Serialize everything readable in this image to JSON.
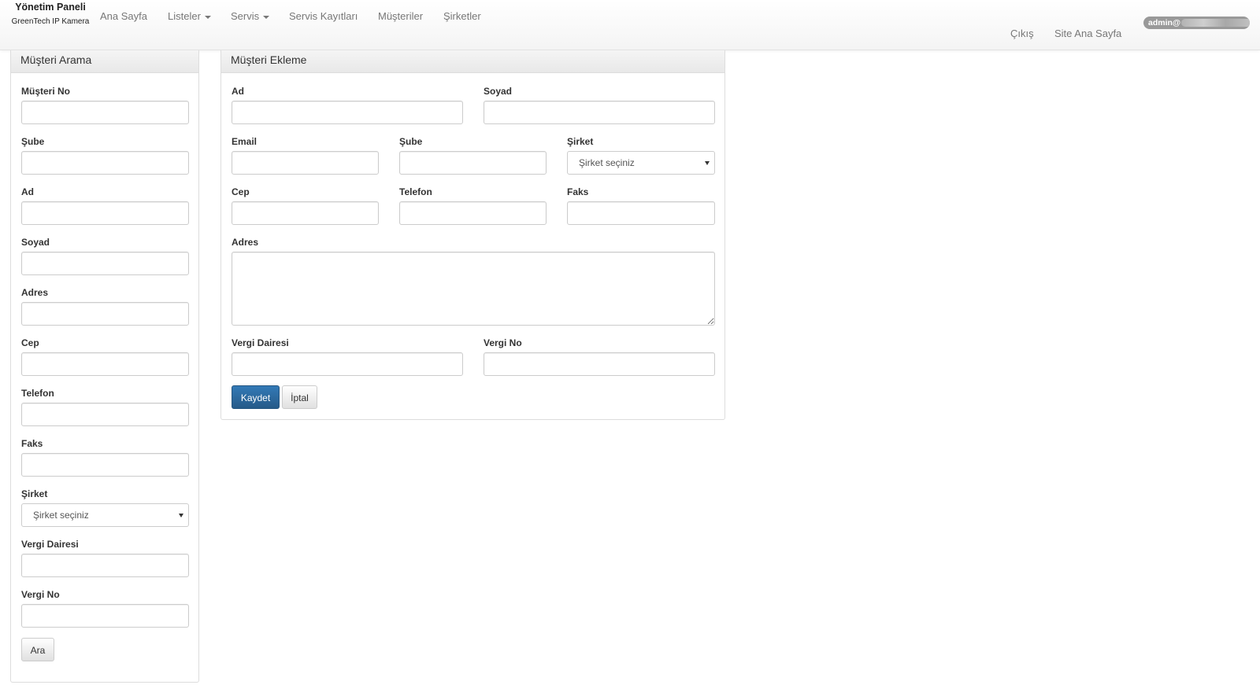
{
  "navbar": {
    "brand_title": "Yönetim Paneli",
    "brand_subtitle": "GreenTech IP Kamera",
    "items": [
      {
        "label": "Ana Sayfa",
        "dropdown": false
      },
      {
        "label": "Listeler",
        "dropdown": true
      },
      {
        "label": "Servis",
        "dropdown": true
      },
      {
        "label": "Servis Kayıtları",
        "dropdown": false
      },
      {
        "label": "Müşteriler",
        "dropdown": false
      },
      {
        "label": "Şirketler",
        "dropdown": false
      }
    ],
    "user_email_visible": "admin@",
    "logout": "Çıkış",
    "site_home": "Site Ana Sayfa"
  },
  "search_panel": {
    "title": "Müşteri Arama",
    "fields": {
      "musteri_no": "Müşteri No",
      "sube": "Şube",
      "ad": "Ad",
      "soyad": "Soyad",
      "adres": "Adres",
      "cep": "Cep",
      "telefon": "Telefon",
      "faks": "Faks",
      "sirket": "Şirket",
      "vergi_dairesi": "Vergi Dairesi",
      "vergi_no": "Vergi No"
    },
    "sirket_selected": "Şirket seçiniz",
    "search_button": "Ara"
  },
  "add_panel": {
    "title": "Müşteri Ekleme",
    "fields": {
      "ad": "Ad",
      "soyad": "Soyad",
      "email": "Email",
      "sube": "Şube",
      "sirket": "Şirket",
      "cep": "Cep",
      "telefon": "Telefon",
      "faks": "Faks",
      "adres": "Adres",
      "vergi_dairesi": "Vergi Dairesi",
      "vergi_no": "Vergi No"
    },
    "sirket_selected": "Şirket seçiniz",
    "save_button": "Kaydet",
    "cancel_button": "İptal"
  },
  "colors": {
    "primary": "#337ab7",
    "badge": "#999999",
    "nav_text": "#777777"
  }
}
